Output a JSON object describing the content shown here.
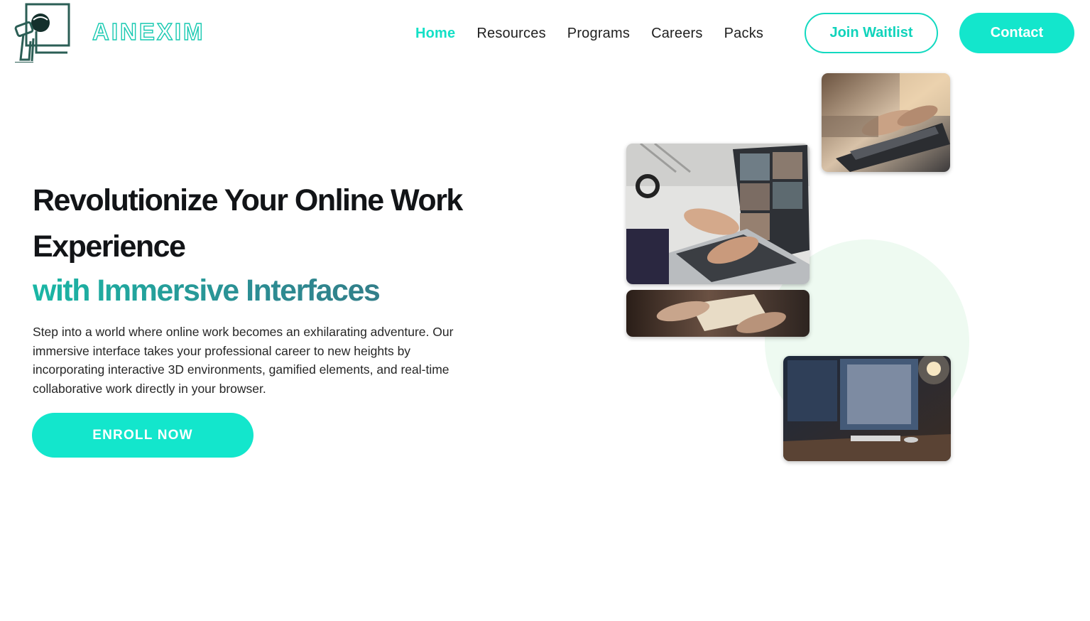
{
  "brand": {
    "name": "AINEXIM",
    "accent_color": "#13e6cc",
    "logo_icon": "robot-at-screen-icon"
  },
  "nav": {
    "items": [
      {
        "label": "Home",
        "active": true
      },
      {
        "label": "Resources",
        "active": false
      },
      {
        "label": "Programs",
        "active": false
      },
      {
        "label": "Careers",
        "active": false
      },
      {
        "label": "Packs",
        "active": false
      }
    ],
    "waitlist_label": "Join Waitlist",
    "contact_label": "Contact"
  },
  "hero": {
    "title_line1": "Revolutionize Your Online Work",
    "title_line2": "Experience",
    "title_highlight": "with Immersive Interfaces",
    "description": "Step into a world where online work becomes an exhilarating adventure. Our immersive interface takes your professional career to new heights by incorporating interactive 3D environments, gamified elements, and real-time collaborative work directly in your browser.",
    "cta_label": "ENROLL NOW"
  },
  "gallery": {
    "images": [
      {
        "subject": "hands-typing-laptop-image"
      },
      {
        "subject": "video-call-laptop-image"
      },
      {
        "subject": "handshake-document-image"
      },
      {
        "subject": "desktop-monitors-image"
      }
    ]
  }
}
